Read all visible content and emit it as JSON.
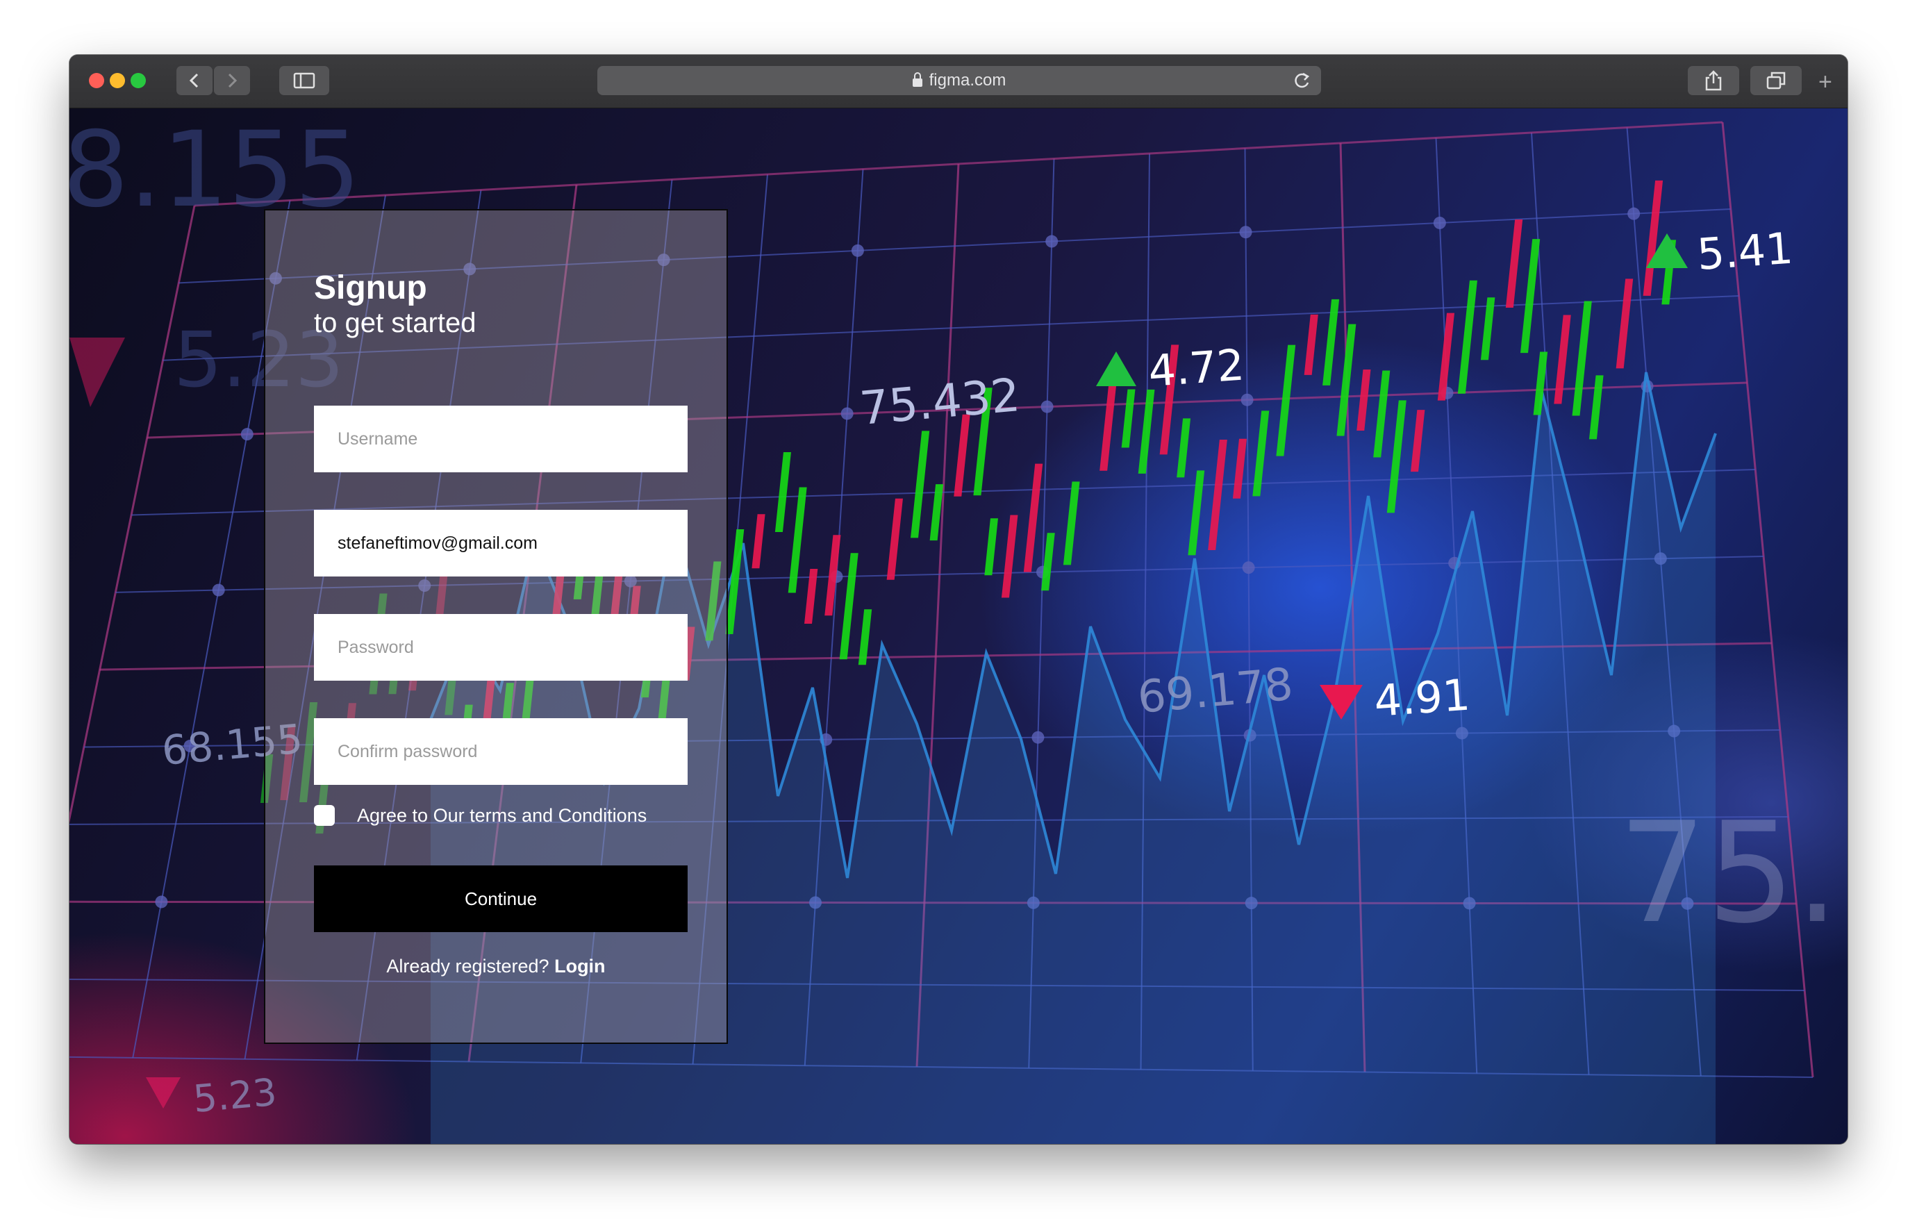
{
  "browser": {
    "url": "figma.com",
    "colors": {
      "close": "#ff5f57",
      "minimize": "#febc2e",
      "maximize": "#28c840"
    },
    "icons": [
      "back-icon",
      "forward-icon",
      "sidebar-icon",
      "lock-icon",
      "reload-icon",
      "share-icon",
      "tabs-icon",
      "new-tab-icon"
    ]
  },
  "background": {
    "labels": {
      "big_top": "8.155",
      "left_faded": "5.23",
      "left_mid": "68.155",
      "bottom_left": "5.23",
      "top_mid": "75.432",
      "up1": "4.72",
      "up2": "5.41",
      "center": "69.178",
      "down": "4.91",
      "right_big": "75."
    },
    "colors": {
      "up": "#16d816",
      "down": "#e8184f",
      "grid": "#b03a86",
      "line": "#2f88d8"
    }
  },
  "form": {
    "title": "Signup",
    "subtitle": "to get started",
    "username_placeholder": "Username",
    "email_value": "stefaneftimov@gmail.com",
    "password_placeholder": "Password",
    "confirm_placeholder": "Confirm password",
    "agree_label": "Agree to Our terms and Conditions",
    "continue_label": "Continue",
    "already_text": "Already registered?",
    "login_label": "Login"
  }
}
